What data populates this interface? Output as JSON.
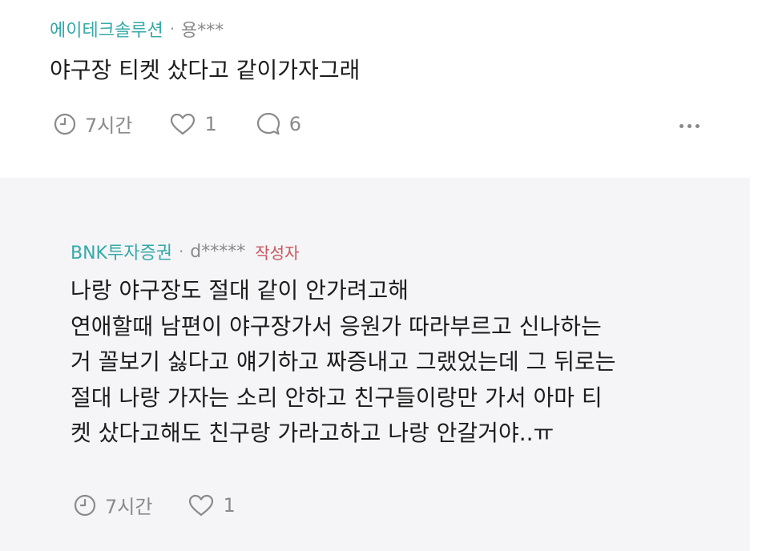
{
  "comment": {
    "company": "에이테크솔루션",
    "separator": "·",
    "user": "용***",
    "text": "야구장 티켓 샀다고 같이가자그래",
    "time": "7시간",
    "likes": "1",
    "replies": "6",
    "icons": {
      "time": "clock-icon",
      "like": "heart-icon",
      "reply": "speech-bubble-icon",
      "more": "more-dots-icon"
    }
  },
  "reply": {
    "company": "BNK투자증권",
    "separator": "·",
    "user": "d*****",
    "author_tag": "작성자",
    "lines": [
      "나랑 야구장도 절대 같이 안가려고해",
      "연애할때 남편이 야구장가서 응원가 따라부르고 신나하는",
      "거 꼴보기 싫다고 얘기하고 짜증내고 그랬었는데 그 뒤로는",
      "절대 나랑 가자는 소리 안하고 친구들이랑만 가서 아마 티",
      "켓 샀다고해도 친구랑 가라고하고 나랑 안갈거야..ㅠ"
    ],
    "time": "7시간",
    "likes": "1",
    "icons": {
      "time": "clock-icon",
      "like": "heart-icon"
    }
  },
  "colors": {
    "company": "#36a9a8",
    "author_tag": "#c9555c",
    "meta_gray": "#8a8a8a",
    "reply_background": "#f5f5f7"
  }
}
